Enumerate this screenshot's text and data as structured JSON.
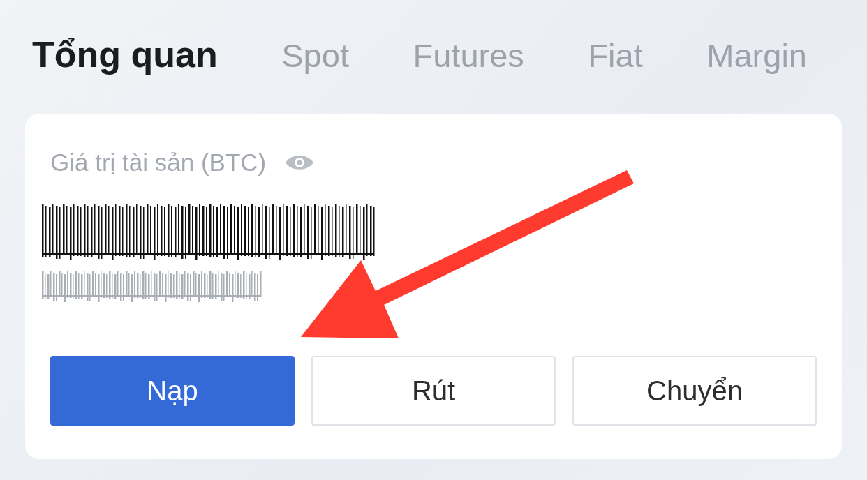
{
  "tabs": [
    {
      "label": "Tổng quan",
      "selected": true
    },
    {
      "label": "Spot",
      "selected": false
    },
    {
      "label": "Futures",
      "selected": false
    },
    {
      "label": "Fiat",
      "selected": false
    },
    {
      "label": "Margin",
      "selected": false
    }
  ],
  "asset_card": {
    "label": "Giá trị tài sản (BTC)",
    "masked_values": [
      {
        "kind": "primary"
      },
      {
        "kind": "secondary"
      }
    ],
    "buttons": [
      {
        "label": "Nạp",
        "kind": "primary"
      },
      {
        "label": "Rút",
        "kind": "outline"
      },
      {
        "label": "Chuyển",
        "kind": "outline"
      }
    ]
  },
  "annotations": [
    {
      "kind": "arrow"
    }
  ]
}
